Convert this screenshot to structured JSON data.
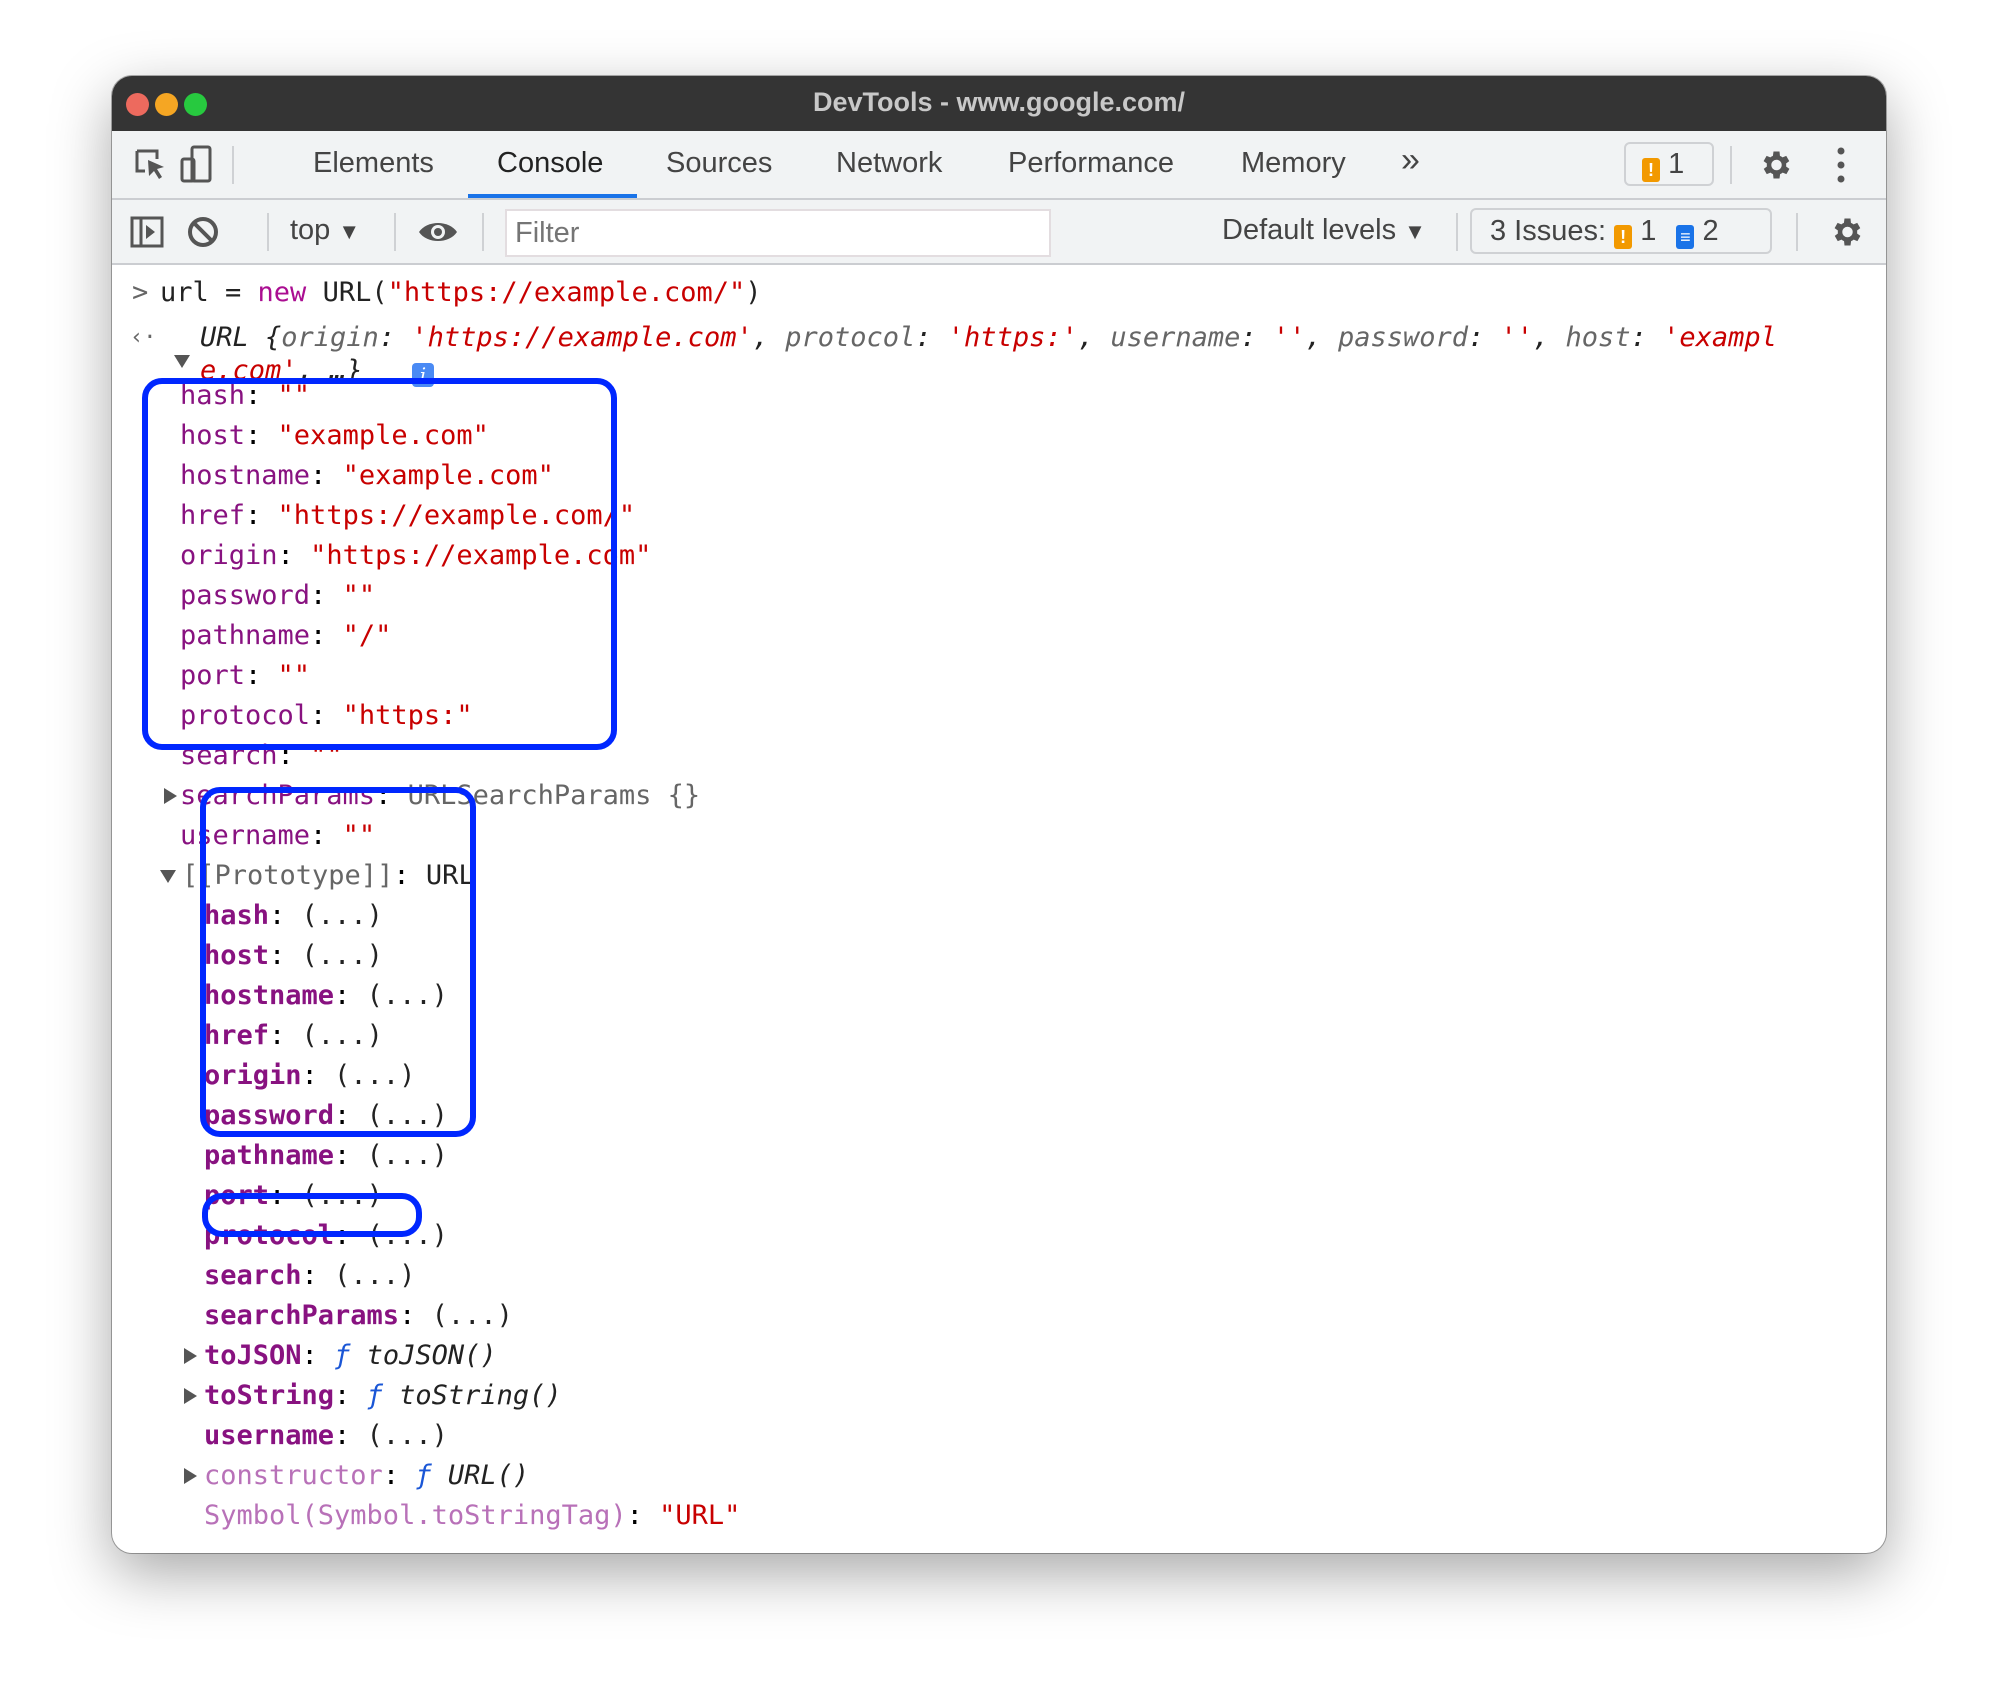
{
  "window": {
    "title": "DevTools - www.google.com/"
  },
  "tabs": [
    {
      "label": "Elements"
    },
    {
      "label": "Console",
      "active": true
    },
    {
      "label": "Sources"
    },
    {
      "label": "Network"
    },
    {
      "label": "Performance"
    },
    {
      "label": "Memory"
    }
  ],
  "tabs_more": "»",
  "warning_badge_count": "1",
  "toolbar": {
    "context": "top",
    "filter_placeholder": "Filter",
    "levels": "Default levels",
    "issues_label": "3 Issues:",
    "issues_warn": "1",
    "issues_info": "2"
  },
  "colors": {
    "accent": "#1a73e8",
    "highlight_box": "#0027ff",
    "key": "#881280",
    "string": "#c80000",
    "warning": "#f29900"
  },
  "console": {
    "input_prompt": ">",
    "input": [
      {
        "t": "url = ",
        "c": "n"
      },
      {
        "t": "new",
        "c": "kw"
      },
      {
        "t": " URL(",
        "c": "n"
      },
      {
        "t": "\"https://example.com/\"",
        "c": "s"
      },
      {
        "t": ")",
        "c": "n"
      }
    ],
    "result_line1": [
      {
        "t": "URL {",
        "c": "n i"
      },
      {
        "t": "origin",
        "c": "g i"
      },
      {
        "t": ": ",
        "c": "n i"
      },
      {
        "t": "'https://example.com'",
        "c": "s i"
      },
      {
        "t": ", ",
        "c": "n i"
      },
      {
        "t": "protocol",
        "c": "g i"
      },
      {
        "t": ": ",
        "c": "n i"
      },
      {
        "t": "'https:'",
        "c": "s i"
      },
      {
        "t": ", ",
        "c": "n i"
      },
      {
        "t": "username",
        "c": "g i"
      },
      {
        "t": ": ",
        "c": "n i"
      },
      {
        "t": "''",
        "c": "s i"
      },
      {
        "t": ", ",
        "c": "n i"
      },
      {
        "t": "password",
        "c": "g i"
      },
      {
        "t": ": ",
        "c": "n i"
      },
      {
        "t": "''",
        "c": "s i"
      },
      {
        "t": ", ",
        "c": "n i"
      },
      {
        "t": "host",
        "c": "g i"
      },
      {
        "t": ": ",
        "c": "n i"
      },
      {
        "t": "'exampl",
        "c": "s i"
      }
    ],
    "result_line2": [
      {
        "t": "e.com'",
        "c": "s i"
      },
      {
        "t": ", …}",
        "c": "n i"
      }
    ],
    "own_props": [
      {
        "key": "hash",
        "value": "\"\""
      },
      {
        "key": "host",
        "value": "\"example.com\""
      },
      {
        "key": "hostname",
        "value": "\"example.com\""
      },
      {
        "key": "href",
        "value": "\"https://example.com/\""
      },
      {
        "key": "origin",
        "value": "\"https://example.com\""
      },
      {
        "key": "password",
        "value": "\"\""
      },
      {
        "key": "pathname",
        "value": "\"/\""
      },
      {
        "key": "port",
        "value": "\"\""
      },
      {
        "key": "protocol",
        "value": "\"https:\""
      },
      {
        "key": "search",
        "value": "\"\""
      },
      {
        "key": "searchParams",
        "value": "URLSearchParams {}",
        "expandable": true,
        "plain": true
      },
      {
        "key": "username",
        "value": "\"\""
      }
    ],
    "prototype_label": "[[Prototype]]",
    "prototype_value": "URL",
    "proto_props": [
      {
        "key": "hash",
        "value": "(...)"
      },
      {
        "key": "host",
        "value": "(...)"
      },
      {
        "key": "hostname",
        "value": "(...)"
      },
      {
        "key": "href",
        "value": "(...)"
      },
      {
        "key": "origin",
        "value": "(...)"
      },
      {
        "key": "password",
        "value": "(...)"
      },
      {
        "key": "pathname",
        "value": "(...)"
      },
      {
        "key": "port",
        "value": "(...)"
      },
      {
        "key": "protocol",
        "value": "(...)"
      },
      {
        "key": "search",
        "value": "(...)"
      },
      {
        "key": "searchParams",
        "value": "(...)"
      },
      {
        "key": "toJSON",
        "fn": "toJSON()",
        "expandable": true
      },
      {
        "key": "toString",
        "fn": "toString()",
        "expandable": true
      },
      {
        "key": "username",
        "value": "(...)"
      },
      {
        "key": "constructor",
        "fn": "URL()",
        "expandable": true,
        "light": true
      },
      {
        "key": "Symbol(Symbol.toStringTag)",
        "value": "\"URL\"",
        "light": true,
        "string": true
      }
    ]
  }
}
